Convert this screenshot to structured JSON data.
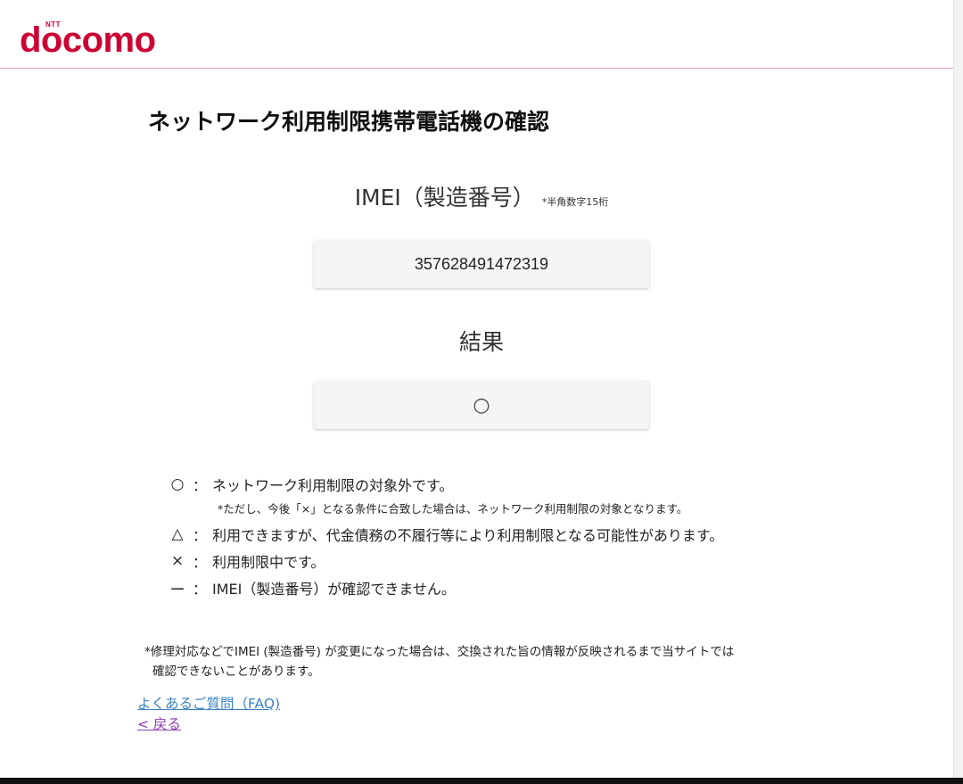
{
  "brand": {
    "ntt": "NTT",
    "name": "docomo",
    "color": "#cc0033"
  },
  "page": {
    "title": "ネットワーク利用制限携帯電話機の確認"
  },
  "imei": {
    "label": "IMEI（製造番号）",
    "note": "*半角数字15桁",
    "value": "357628491472319"
  },
  "result": {
    "label": "結果",
    "symbol": "○"
  },
  "legend": {
    "items": [
      {
        "symbol": "○",
        "colon": "：",
        "text": "ネットワーク利用制限の対象外です。"
      },
      {
        "symbol": "△",
        "colon": "：",
        "text": "利用できますが、代金債務の不履行等により利用制限となる可能性があります。"
      },
      {
        "symbol": "×",
        "colon": "：",
        "text": "利用制限中です。"
      },
      {
        "symbol": "ー",
        "colon": "：",
        "text": "IMEI（製造番号）が確認できません。"
      }
    ],
    "sub_note": "*ただし、今後「×」となる条件に合致した場合は、ネットワーク利用制限の対象となります。"
  },
  "footnote": {
    "line1": "*修理対応などでIMEI (製造番号) が変更になった場合は、交換された旨の情報が反映されるまで当サイトでは",
    "line2": "確認できないことがあります。"
  },
  "links": {
    "faq": "よくあるご質問（FAQ)",
    "back": "< 戻る"
  }
}
